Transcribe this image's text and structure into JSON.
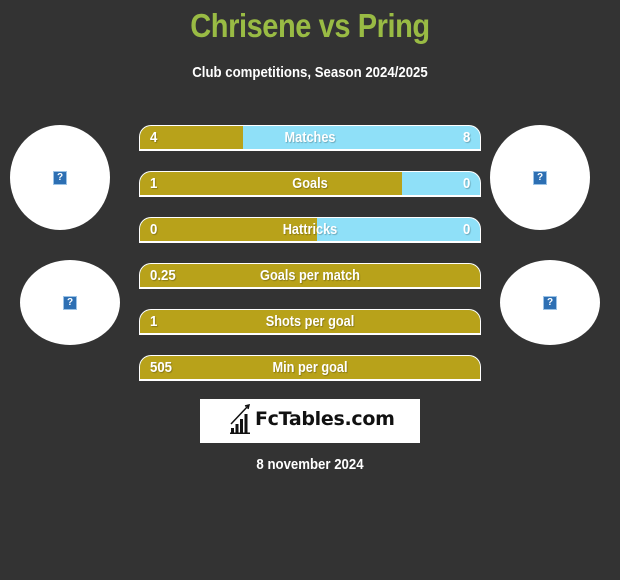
{
  "header": {
    "title": "Chrisene vs Pring",
    "subtitle": "Club competitions, Season 2024/2025"
  },
  "teams": {
    "left": {
      "name": "Chrisene",
      "logo_icon": "broken-image-icon",
      "logo_glyph": "?"
    },
    "right": {
      "name": "Pring",
      "logo_icon": "broken-image-icon",
      "logo_glyph": "?"
    }
  },
  "colors": {
    "title": "#99bb44",
    "left_bar": "#b8a21a",
    "right_bar": "#8fe0f8",
    "background": "#333333"
  },
  "stats": [
    {
      "label": "Matches",
      "left": "4",
      "right": "8",
      "left_share": 0.303
    },
    {
      "label": "Goals",
      "left": "1",
      "right": "0",
      "left_share": 0.77
    },
    {
      "label": "Hattricks",
      "left": "0",
      "right": "0",
      "left_share": 0.52
    },
    {
      "label": "Goals per match",
      "left": "0.25",
      "right": "",
      "left_share": 1.0
    },
    {
      "label": "Shots per goal",
      "left": "1",
      "right": "",
      "left_share": 1.0
    },
    {
      "label": "Min per goal",
      "left": "505",
      "right": "",
      "left_share": 1.0
    }
  ],
  "branding": {
    "logo_text": "FcTables.com",
    "logo_icon": "bar-chart-icon"
  },
  "footer": {
    "date": "8 november 2024"
  }
}
